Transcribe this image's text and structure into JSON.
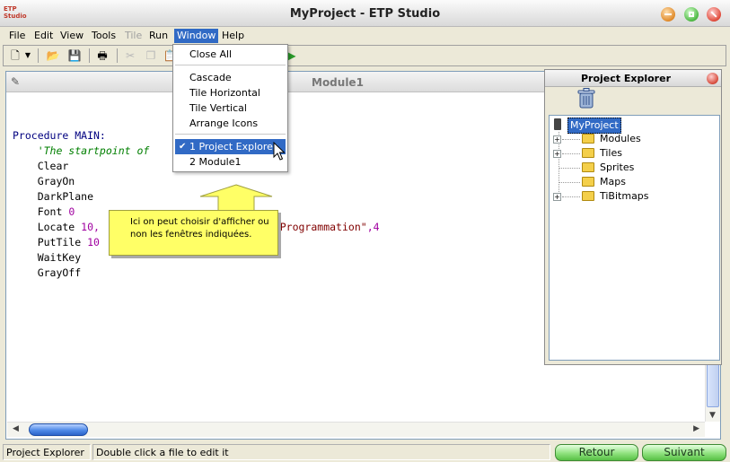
{
  "window": {
    "title": "MyProject - ETP Studio",
    "logo_text": "ETP\nStudio"
  },
  "menubar": {
    "items": [
      {
        "label": "File",
        "state": "normal"
      },
      {
        "label": "Edit",
        "state": "normal"
      },
      {
        "label": "View",
        "state": "normal"
      },
      {
        "label": "Tools",
        "state": "normal"
      },
      {
        "label": "Tile",
        "state": "disabled"
      },
      {
        "label": "Run",
        "state": "normal"
      },
      {
        "label": "Window",
        "state": "active"
      },
      {
        "label": "Help",
        "state": "normal"
      }
    ]
  },
  "toolbar": {
    "buttons": [
      "new-icon",
      "dropdown-arrow-icon",
      "open-folder-icon",
      "save-icon",
      "print-icon",
      "cut-icon",
      "copy-icon",
      "paste-icon",
      "run-icon"
    ]
  },
  "editor": {
    "title": "Module1",
    "code": {
      "line1_kw": "Procedure MAIN:",
      "line2_comment": "    'The startpoint of",
      "line3": "    Clear",
      "line4": "    GrayOn",
      "line5": "    DarkPlane",
      "line6_kw": "    Font ",
      "line6_num": "0",
      "line7_kw": "    Locate ",
      "line7_num": "10,",
      "line7_str": "n TI-Programmation\"",
      "line7_tail": ",4",
      "line8_kw": "    PutTile ",
      "line8_num": "10",
      "line9": "    WaitKey",
      "line10": "    GrayOff"
    }
  },
  "window_menu": {
    "close_all": "Close All",
    "cascade": "Cascade",
    "tile_horizontal": "Tile Horizontal",
    "tile_vertical": "Tile Vertical",
    "arrange_icons": "Arrange Icons",
    "window1": "1 Project Explorer",
    "window2": "2 Module1",
    "checked_item": "1 Project Explorer"
  },
  "callout": {
    "text": "Ici on peut choisir d'afficher ou non les fenêtres indiquées."
  },
  "project_explorer": {
    "title": "Project Explorer",
    "root": "MyProject",
    "children": [
      {
        "label": "Modules",
        "expandable": true
      },
      {
        "label": "Tiles",
        "expandable": true
      },
      {
        "label": "Sprites",
        "expandable": false
      },
      {
        "label": "Maps",
        "expandable": false
      },
      {
        "label": "TiBitmaps",
        "expandable": true
      }
    ]
  },
  "statusbar": {
    "panel": "Project Explorer",
    "message": "Double click a file to edit it",
    "back_button": "Retour",
    "next_button": "Suivant"
  }
}
